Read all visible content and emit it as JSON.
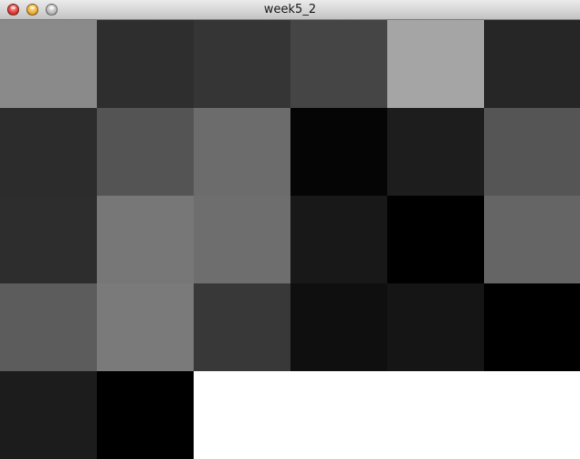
{
  "window": {
    "title": "week5_2",
    "traffic_lights": [
      "close-button",
      "minimize-button",
      "zoom-button"
    ]
  },
  "sketch": {
    "background": "#ffffff",
    "grid_columns": 6,
    "grid_rows": 5,
    "cells": [
      [
        "#8a8a8a",
        "#2e2e2e",
        "#353535",
        "#454545",
        "#a5a5a5",
        "#262626"
      ],
      [
        "#2c2c2c",
        "#545454",
        "#6c6c6c",
        "#050505",
        "#1d1d1d",
        "#555555"
      ],
      [
        "#2d2d2d",
        "#777777",
        "#6e6e6e",
        "#181818",
        "#000000",
        "#656565"
      ],
      [
        "#5c5c5c",
        "#7a7a7a",
        "#383838",
        "#0f0f0f",
        "#151515",
        "#000000"
      ],
      [
        "#1c1c1c",
        "#000000"
      ]
    ]
  }
}
